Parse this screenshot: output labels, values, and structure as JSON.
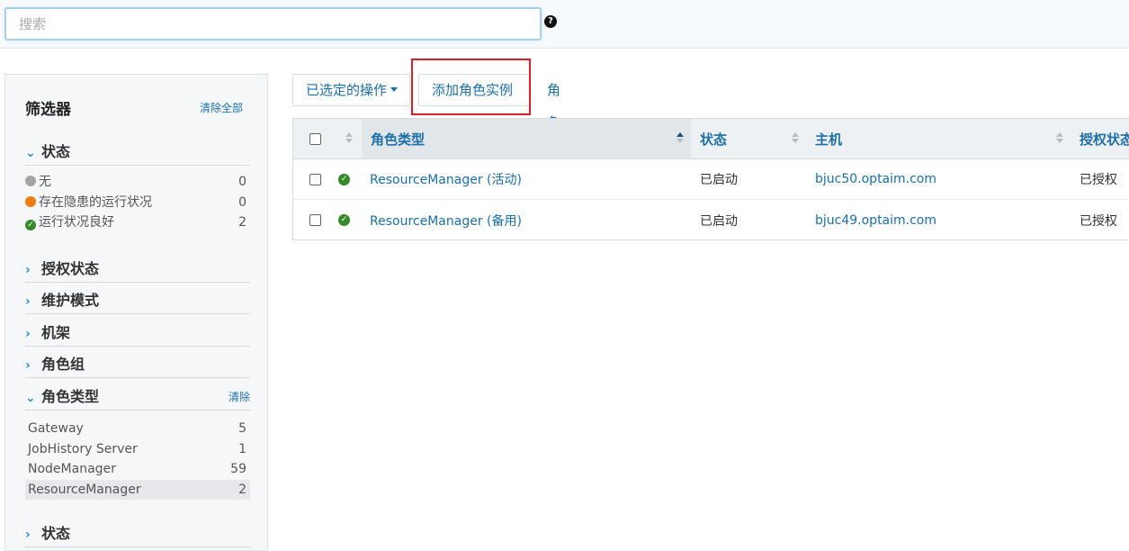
{
  "search": {
    "placeholder": "搜索",
    "help_glyph": "?"
  },
  "filters": {
    "title": "筛选器",
    "clear_all": "清除全部",
    "status_group": {
      "title": "状态",
      "items": [
        {
          "label": "无",
          "count": "0",
          "color": "#a5a5a5"
        },
        {
          "label": "存在隐患的运行状况",
          "count": "0",
          "color": "#f07d14"
        },
        {
          "label": "运行状况良好",
          "count": "2",
          "color": "#378a2a"
        }
      ]
    },
    "collapsed_groups": [
      "授权状态",
      "维护模式",
      "机架",
      "角色组"
    ],
    "role_type_group": {
      "title": "角色类型",
      "clear": "清除",
      "items": [
        {
          "label": "Gateway",
          "count": "5"
        },
        {
          "label": "JobHistory Server",
          "count": "1"
        },
        {
          "label": "NodeManager",
          "count": "59"
        },
        {
          "label": "ResourceManager",
          "count": "2",
          "selected": true
        }
      ]
    },
    "bottom_group": "状态"
  },
  "toolbar": {
    "actions_label": "已选定的操作",
    "add_role_instance_label": "添加角色实例",
    "role_group_label": "角色组"
  },
  "table": {
    "columns": [
      "角色类型",
      "状态",
      "主机",
      "授权状态"
    ],
    "rows": [
      {
        "role_type": "ResourceManager (活动)",
        "status": "已启动",
        "host": "bjuc50.optaim.com",
        "commission": "已授权"
      },
      {
        "role_type": "ResourceManager (备用)",
        "status": "已启动",
        "host": "bjuc49.optaim.com",
        "commission": "已授权"
      }
    ]
  },
  "colors": {
    "accent": "#1c6fa8",
    "ok": "#378a2a",
    "warning": "#f07d14",
    "highlight": "#d6202a"
  }
}
